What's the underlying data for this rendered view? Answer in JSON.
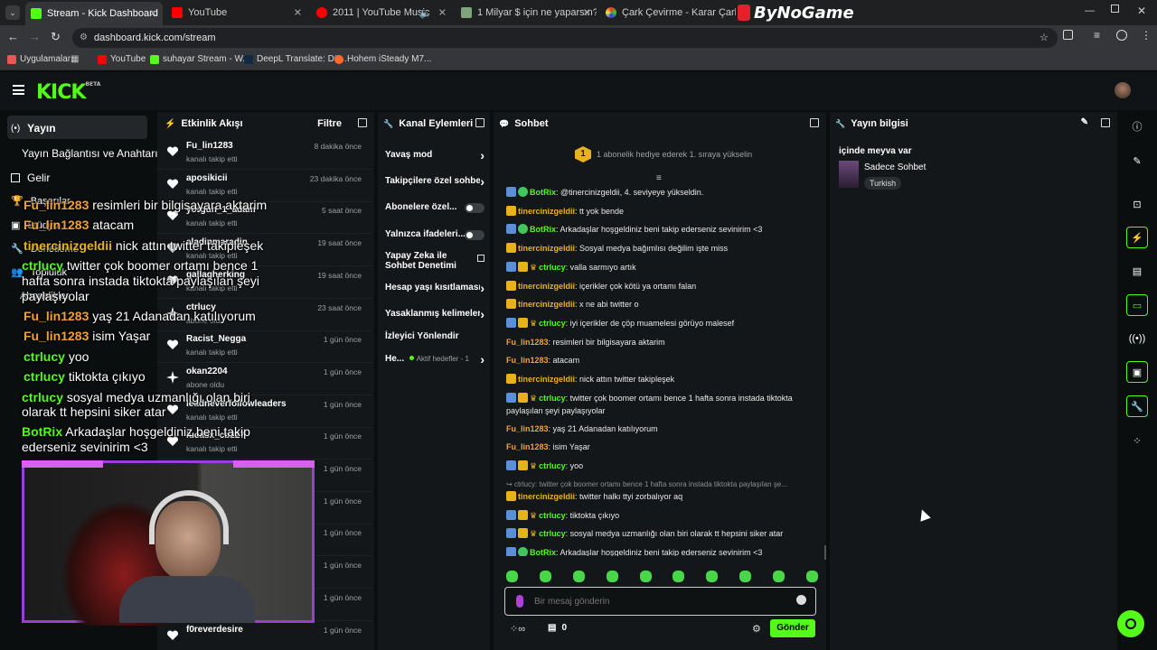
{
  "browser": {
    "tabs": [
      {
        "title": "Stream - Kick Dashboard",
        "active": true
      },
      {
        "title": "YouTube"
      },
      {
        "title": "2011 | YouTube Music"
      },
      {
        "title": "1 Milyar $ için ne yaparsın? - Ti"
      },
      {
        "title": "Çark Çevirme - Karar Çarkı"
      }
    ],
    "watermark": "ByNoGame",
    "url": "dashboard.kick.com/stream",
    "bookmarks": [
      "Uygulamalar",
      "YouTube",
      "suhayar Stream - W...",
      "DeepL Translate: Dü...",
      "Hohem iSteady M7..."
    ]
  },
  "colors": {
    "kick_green": "#53fc18",
    "panel": "#141719",
    "bg": "#0b0e0f"
  },
  "app": {
    "logo": "KICK",
    "logo_sup": "BETA",
    "left_menu": {
      "items": [
        "Yayın",
        "Yayın Bağlantısı ve Anahtarı",
        "Gelir",
        "Başarılar",
        "Stüdyo",
        "Denetleme",
        "Topluluk",
        "Abonelikler"
      ]
    },
    "activity": {
      "title": "Etkinlik Akışı",
      "filter": "Filtre",
      "rows": [
        {
          "user": "Fu_lin1283",
          "action": "kanalı takip etti",
          "time": "8 dakika önce"
        },
        {
          "user": "aposikicii",
          "action": "kanalı takip etti",
          "time": "23 dakika önce"
        },
        {
          "user": "yorgun_1_adam",
          "action": "kanalı takip etti",
          "time": "5 saat önce"
        },
        {
          "user": "aladinmaradin",
          "action": "kanalı takip etti",
          "time": "19 saat önce"
        },
        {
          "user": "gallagherking",
          "action": "kanalı takip etti",
          "time": "19 saat önce"
        },
        {
          "user": "ctrlucy",
          "action": "abone oldu",
          "time": "23 saat önce"
        },
        {
          "user": "Racist_Negga",
          "action": "kanalı takip etti",
          "time": "1 gün önce"
        },
        {
          "user": "okan2204",
          "action": "abone oldu",
          "time": "1 gün önce"
        },
        {
          "user": "leadneverfollowleaders",
          "action": "kanalı takip etti",
          "time": "1 gün önce"
        },
        {
          "user": "lucasx_cb227",
          "action": "kanalı takip etti",
          "time": "1 gün önce"
        },
        {
          "user": "",
          "action": "",
          "time": "1 gün önce"
        },
        {
          "user": "",
          "action": "",
          "time": "1 gün önce"
        },
        {
          "user": "",
          "action": "",
          "time": "1 gün önce"
        },
        {
          "user": "",
          "action": "",
          "time": "1 gün önce"
        },
        {
          "user": "",
          "action": "",
          "time": "1 gün önce"
        },
        {
          "user": "f0reverdesire",
          "action": "",
          "time": "1 gün önce"
        }
      ]
    },
    "channel_actions": {
      "title": "Kanal Eylemleri",
      "items": [
        {
          "label": "Yavaş mod",
          "control": "arrow"
        },
        {
          "label": "Takipçilere özel sohbet",
          "control": "arrow"
        },
        {
          "label": "Abonelere özel...",
          "control": "toggle"
        },
        {
          "label": "Yalnızca ifadeleri...",
          "control": "toggle"
        },
        {
          "label": "Yapay Zeka ile Sohbet Denetimi",
          "control": "ext"
        },
        {
          "label": "Hesap yaşı kısıtlaması",
          "control": "arrow"
        },
        {
          "label": "Yasaklanmış kelimeler",
          "control": "arrow"
        },
        {
          "label": "İzleyici Yönlendir",
          "control": "none"
        },
        {
          "label": "He...",
          "control": "arrow",
          "extra": "Aktif hedefler - 1"
        }
      ]
    },
    "chat": {
      "title": "Sohbet",
      "sub_banner_num": "1",
      "sub_banner": "1 abonelik hediye ederek 1. sıraya yükselin",
      "messages": [
        {
          "user": "BotRix",
          "color": "#53fc18",
          "badges": [
            "blue",
            "green"
          ],
          "text": "@tinercinizgeldii, 4. seviyeye yükseldin."
        },
        {
          "user": "tinercinizgeldii",
          "color": "#e8b31a",
          "badges": [
            "yellow"
          ],
          "text": "tt yok bende"
        },
        {
          "user": "BotRix",
          "color": "#53fc18",
          "badges": [
            "blue",
            "green"
          ],
          "text": "Arkadaşlar hoşgeldiniz beni takip ederseniz sevinirim <3"
        },
        {
          "user": "tinercinizgeldii",
          "color": "#e8b31a",
          "badges": [
            "yellow"
          ],
          "text": "Sosyal medya bağımlısı değilim işte miss"
        },
        {
          "user": "ctrlucy",
          "color": "#53fc18",
          "badges": [
            "blue",
            "yellow",
            "crown"
          ],
          "text": "valla sarmıyo artık"
        },
        {
          "user": "tinercinizgeldii",
          "color": "#e8b31a",
          "badges": [
            "yellow"
          ],
          "text": "içerikler çok kötü ya ortamı falan"
        },
        {
          "user": "tinercinizgeldii",
          "color": "#e8b31a",
          "badges": [
            "yellow"
          ],
          "text": "x ne abi twitter o"
        },
        {
          "user": "ctrlucy",
          "color": "#53fc18",
          "badges": [
            "blue",
            "yellow",
            "crown"
          ],
          "text": "iyi içerikler de çöp muamelesi görüyo malesef"
        },
        {
          "user": "Fu_lin1283",
          "color": "#f0a13a",
          "badges": [],
          "text": "resimleri bir bilgisayara aktarim"
        },
        {
          "user": "Fu_lin1283",
          "color": "#f0a13a",
          "badges": [],
          "text": "atacam"
        },
        {
          "user": "tinercinizgeldii",
          "color": "#e8b31a",
          "badges": [
            "yellow"
          ],
          "text": "nick attın twitter takipleşek"
        },
        {
          "user": "ctrlucy",
          "color": "#53fc18",
          "badges": [
            "blue",
            "yellow",
            "crown"
          ],
          "text": "twitter çok boomer ortamı bence 1 hafta sonra instada tiktokta paylaşılan şeyi paylaşıyolar"
        },
        {
          "user": "Fu_lin1283",
          "color": "#f0a13a",
          "badges": [],
          "text": "yaş 21 Adanadan katılıyorum"
        },
        {
          "user": "Fu_lin1283",
          "color": "#f0a13a",
          "badges": [],
          "text": "isim Yaşar"
        },
        {
          "user": "ctrlucy",
          "color": "#53fc18",
          "badges": [
            "blue",
            "yellow",
            "crown"
          ],
          "text": "yoo"
        },
        {
          "user": "",
          "color": "#888",
          "badges": [],
          "text": "ctrlucy: twitter çok boomer ortamı bence 1 hafta sonra instada tiktokta paylaşılan şe..."
        },
        {
          "user": "tinercinizgeldii",
          "color": "#e8b31a",
          "badges": [
            "yellow"
          ],
          "text": "twitter halkı ttyi zorbalıyor aq"
        },
        {
          "user": "ctrlucy",
          "color": "#53fc18",
          "badges": [
            "blue",
            "yellow",
            "crown"
          ],
          "text": "tiktokta çıkıyo"
        },
        {
          "user": "ctrlucy",
          "color": "#53fc18",
          "badges": [
            "blue",
            "yellow",
            "crown"
          ],
          "text": "sosyal medya uzmanlığı olan biri olarak tt hepsini siker atar"
        },
        {
          "user": "BotRix",
          "color": "#53fc18",
          "badges": [
            "blue",
            "green"
          ],
          "text": "Arkadaşlar hoşgeldiniz beni takip ederseniz sevinirim <3"
        }
      ],
      "input_placeholder": "Bir mesaj gönderin",
      "count_value": "0",
      "send_label": "Gönder"
    },
    "stream_info": {
      "title": "Yayın bilgisi",
      "stream_title": "içinde meyva var",
      "category": "Sadece Sohbet",
      "tag": "Turkish"
    },
    "overlay_chat": [
      {
        "user": "Fu_lin1283",
        "color": "#f0a13a",
        "text": "resimleri bir bilgisayara aktarim"
      },
      {
        "user": "Fu_lin1283",
        "color": "#f0a13a",
        "text": "atacam"
      },
      {
        "user": "tinercinizgeldii",
        "color": "#e8b31a",
        "text": "nick attın twitter takipleşek"
      },
      {
        "user": "ctrlucy",
        "color": "#53fc18",
        "text": "twitter çok boomer ortamı bence 1 hafta sonra instada tiktokta paylaşılan şeyi paylaşıyolar"
      },
      {
        "user": "Fu_lin1283",
        "color": "#f0a13a",
        "text": "yaş 21 Adanadan katılıyorum"
      },
      {
        "user": "Fu_lin1283",
        "color": "#f0a13a",
        "text": "isim Yaşar"
      },
      {
        "user": "ctrlucy",
        "color": "#53fc18",
        "text": "yoo"
      },
      {
        "user": "ctrlucy",
        "color": "#53fc18",
        "text": "tiktokta çıkıyo"
      },
      {
        "user": "ctrlucy",
        "color": "#53fc18",
        "text": "sosyal medya uzmanlığı olan biri olarak tt hepsini siker atar"
      },
      {
        "user": "BotRix",
        "color": "#53fc18",
        "text": "Arkadaşlar hoşgeldiniz beni takip ederseniz sevinirim <3"
      }
    ]
  }
}
